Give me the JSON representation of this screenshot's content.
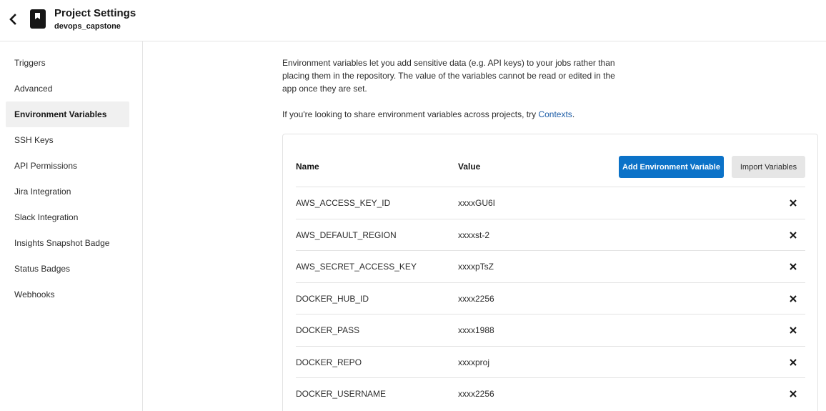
{
  "header": {
    "title": "Project Settings",
    "subtitle": "devops_capstone"
  },
  "sidebar": {
    "items": [
      {
        "label": "Triggers"
      },
      {
        "label": "Advanced"
      },
      {
        "label": "Environment Variables",
        "active": true
      },
      {
        "label": "SSH Keys"
      },
      {
        "label": "API Permissions"
      },
      {
        "label": "Jira Integration"
      },
      {
        "label": "Slack Integration"
      },
      {
        "label": "Insights Snapshot Badge"
      },
      {
        "label": "Status Badges"
      },
      {
        "label": "Webhooks"
      }
    ]
  },
  "main": {
    "intro": "Environment variables let you add sensitive data (e.g. API keys) to your jobs rather than placing them in the repository. The value of the variables cannot be read or edited in the app once they are set.",
    "share_text": "If you're looking to share environment variables across projects, try ",
    "share_link": "Contexts",
    "share_suffix": ".",
    "table": {
      "col_name": "Name",
      "col_value": "Value",
      "add_button": "Add Environment Variable",
      "import_button": "Import Variables",
      "rows": [
        {
          "name": "AWS_ACCESS_KEY_ID",
          "value": "xxxxGU6I"
        },
        {
          "name": "AWS_DEFAULT_REGION",
          "value": "xxxxst-2"
        },
        {
          "name": "AWS_SECRET_ACCESS_KEY",
          "value": "xxxxpTsZ"
        },
        {
          "name": "DOCKER_HUB_ID",
          "value": "xxxx2256"
        },
        {
          "name": "DOCKER_PASS",
          "value": "xxxx1988"
        },
        {
          "name": "DOCKER_REPO",
          "value": "xxxxproj"
        },
        {
          "name": "DOCKER_USERNAME",
          "value": "xxxx2256"
        }
      ]
    }
  },
  "icons": {
    "back": "chevron-left-icon",
    "project": "bookmark-book-icon",
    "delete": "close-icon"
  },
  "colors": {
    "primary": "#0b72c8",
    "link": "#1d5da7",
    "active_bg": "#f0f0f0",
    "border": "#e3e3e3"
  }
}
